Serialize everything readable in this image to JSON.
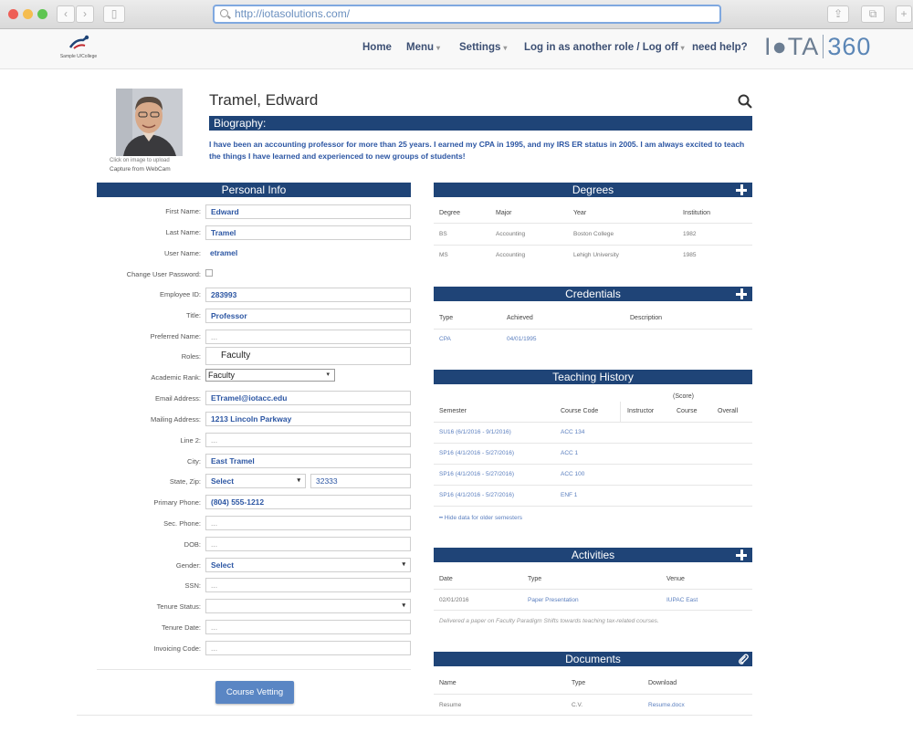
{
  "browser": {
    "url": "http://iotasolutions.com/",
    "traffic_colors": [
      "#ee5f57",
      "#f5bd4f",
      "#5ec551"
    ]
  },
  "header": {
    "school_caption": "Sample U/College",
    "nav": [
      "Home",
      "Menu",
      "Settings",
      "Log in as another role / Log off",
      "need help?"
    ],
    "brand_iota": "I●TA",
    "brand_360": "360"
  },
  "profile": {
    "name": "Tramel, Edward",
    "photo_caption": "Click on image to upload",
    "webcam_caption": "Capture from WebCam",
    "biography_label": "Biography:",
    "biography_text": "I have been an accounting professor for more than 25 years.  I earned my CPA in 1995, and my IRS ER status in 2005.  I am always excited to teach the things I have learned and experienced to new groups of students!"
  },
  "personal_info": {
    "title": "Personal Info",
    "fields": [
      {
        "label": "First Name:",
        "value": "Edward"
      },
      {
        "label": "Last Name:",
        "value": "Tramel"
      },
      {
        "label": "User Name:",
        "value": "etramel"
      },
      {
        "label": "Change User Password:",
        "value": ""
      },
      {
        "label": "Employee ID:",
        "value": "283993"
      },
      {
        "label": "Title:",
        "value": "Professor"
      },
      {
        "label": "Preferred Name:",
        "value": "..."
      },
      {
        "label": "Roles:",
        "value": "Faculty"
      },
      {
        "label": "Academic Rank:",
        "value": "Faculty"
      },
      {
        "label": "Email Address:",
        "value": "ETramel@iotacc.edu"
      },
      {
        "label": "Mailing Address:",
        "value": "1213 Lincoln Parkway"
      },
      {
        "label": "Line 2:",
        "value": "..."
      },
      {
        "label": "City:",
        "value": "East Tramel"
      },
      {
        "label": "State, Zip:",
        "value": "Select",
        "zip": "32333"
      },
      {
        "label": "Primary Phone:",
        "value": "(804) 555-1212"
      },
      {
        "label": "Sec. Phone:",
        "value": "..."
      },
      {
        "label": "DOB:",
        "value": "..."
      },
      {
        "label": "Gender:",
        "value": "Select"
      },
      {
        "label": "SSN:",
        "value": "..."
      },
      {
        "label": "Tenure Status:",
        "value": ""
      },
      {
        "label": "Tenure Date:",
        "value": "..."
      },
      {
        "label": "Invoicing Code:",
        "value": "..."
      }
    ],
    "button": "Course Vetting"
  },
  "degrees": {
    "title": "Degrees",
    "headers": [
      "Degree",
      "Major",
      "Year",
      "Institution"
    ],
    "rows": [
      [
        "BS",
        "Accounting",
        "Boston College",
        "1982"
      ],
      [
        "MS",
        "Accounting",
        "Lehigh University",
        "1985"
      ]
    ]
  },
  "credentials": {
    "title": "Credentials",
    "headers": [
      "Type",
      "Achieved",
      "Description"
    ],
    "rows": [
      [
        "CPA",
        "04/01/1995",
        ""
      ]
    ]
  },
  "teaching": {
    "title": "Teaching History",
    "score_label": "(Score)",
    "headers": [
      "Semester",
      "Course Code",
      "Instructor",
      "Course",
      "Overall"
    ],
    "rows": [
      [
        "SU16 (6/1/2016 - 9/1/2016)",
        "ACC 134"
      ],
      [
        "SP16 (4/1/2016 - 5/27/2016)",
        "ACC 1"
      ],
      [
        "SP16 (4/1/2016 - 5/27/2016)",
        "ACC 100"
      ],
      [
        "SP16 (4/1/2016 - 5/27/2016)",
        "ENF 1"
      ]
    ],
    "hide_link": "Hide data for older semesters"
  },
  "activities": {
    "title": "Activities",
    "headers": [
      "Date",
      "Type",
      "Venue"
    ],
    "rows": [
      [
        "02/01/2016",
        "Paper Presentation",
        "IUPAC East"
      ]
    ],
    "note": "Delivered a paper on Faculty Paradigm Shifts towards teaching tax-related courses."
  },
  "documents": {
    "title": "Documents",
    "headers": [
      "Name",
      "Type",
      "Download"
    ],
    "rows": [
      [
        "Resume",
        "C.V.",
        "Resume.docx"
      ]
    ]
  }
}
